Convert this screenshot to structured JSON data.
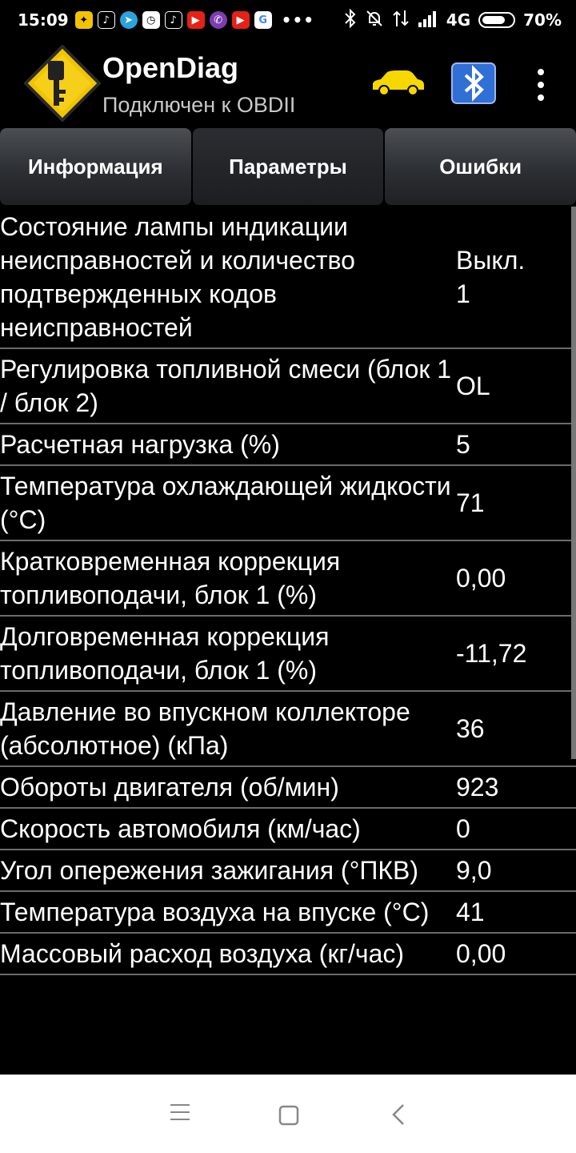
{
  "status_bar": {
    "time": "15:09",
    "network": "4G",
    "battery": "70%",
    "notification_icons": [
      "yellow-app-icon",
      "tiktok-icon",
      "telegram-icon",
      "clock-app-icon",
      "tiktok-icon",
      "youtube-icon",
      "viber-icon",
      "youtube-icon",
      "google-icon"
    ]
  },
  "app": {
    "title": "OpenDiag",
    "subtitle": "Подключен к OBDII"
  },
  "tabs": [
    {
      "label": "Информация"
    },
    {
      "label": "Параметры"
    },
    {
      "label": "Ошибки"
    }
  ],
  "parameters": [
    {
      "name": "Состояние лампы индикации неисправностей и количество подтвержденных кодов неисправностей",
      "value": "Выкл.\n1"
    },
    {
      "name": "Регулировка топливной смеси (блок 1 / блок 2)",
      "value": "OL"
    },
    {
      "name": "Расчетная нагрузка (%)",
      "value": "5"
    },
    {
      "name": "Температура охлаждающей жидкости (°C)",
      "value": "71"
    },
    {
      "name": "Кратковременная коррекция топливоподачи, блок 1 (%)",
      "value": "0,00"
    },
    {
      "name": "Долговременная коррекция топливоподачи, блок 1 (%)",
      "value": "-11,72"
    },
    {
      "name": "Давление во впускном коллекторе (абсолютное) (кПа)",
      "value": "36"
    },
    {
      "name": "Обороты двигателя (об/мин)",
      "value": "923"
    },
    {
      "name": "Скорость автомобиля (км/час)",
      "value": "0"
    },
    {
      "name": "Угол опережения зажигания (°ПКВ)",
      "value": "9,0"
    },
    {
      "name": "Температура воздуха на впуске (°C)",
      "value": "41"
    },
    {
      "name": "Массовый расход воздуха (кг/час)",
      "value": "0,00"
    }
  ],
  "colors": {
    "background": "#000000",
    "divider": "#6b6b6b",
    "car": "#f5d800",
    "bluetooth": "#2f6fd6"
  }
}
